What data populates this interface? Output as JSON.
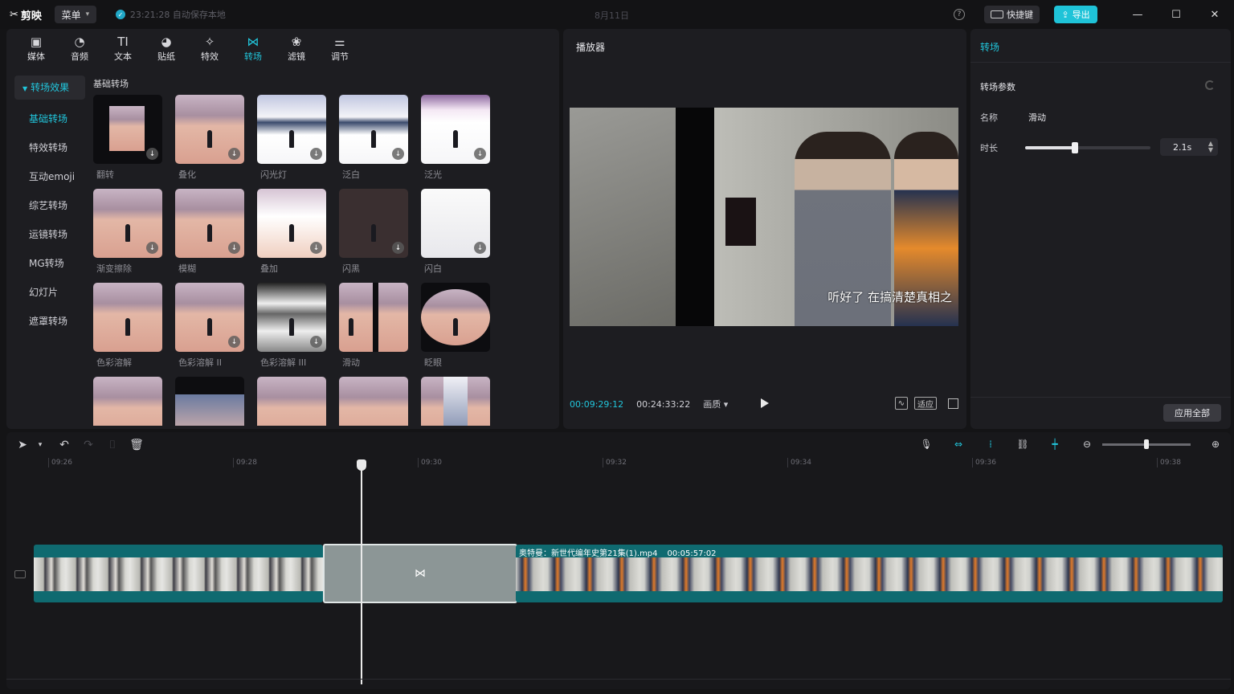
{
  "app": {
    "logo_text": "剪映",
    "menu_label": "菜单",
    "autosave_text": "23:21:28 自动保存本地",
    "project_title": "8月11日",
    "shortcut_label": "快捷键",
    "export_label": "导出"
  },
  "tools": [
    {
      "label": "媒体",
      "icon": "media-icon"
    },
    {
      "label": "音频",
      "icon": "audio-icon"
    },
    {
      "label": "文本",
      "icon": "text-icon"
    },
    {
      "label": "贴纸",
      "icon": "sticker-icon"
    },
    {
      "label": "特效",
      "icon": "effects-icon"
    },
    {
      "label": "转场",
      "icon": "transition-icon",
      "active": true
    },
    {
      "label": "滤镜",
      "icon": "filter-icon"
    },
    {
      "label": "调节",
      "icon": "adjust-icon"
    }
  ],
  "categories": {
    "header": "转场效果",
    "items": [
      "基础转场",
      "特效转场",
      "互动emoji",
      "综艺转场",
      "运镜转场",
      "MG转场",
      "幻灯片",
      "遮罩转场"
    ],
    "selected_index": 0
  },
  "section_title": "基础转场",
  "transitions": [
    "翻转",
    "叠化",
    "闪光灯",
    "泛白",
    "泛光",
    "渐变擦除",
    "模糊",
    "叠加",
    "闪黑",
    "闪白",
    "色彩溶解",
    "色彩溶解 II",
    "色彩溶解 III",
    "滑动",
    "眨眼",
    "",
    "",
    "",
    "",
    ""
  ],
  "player": {
    "title": "播放器",
    "subtitle": "听好了 在搞清楚真相之",
    "current_time": "00:09:29:12",
    "total_time": "00:24:33:22",
    "quality": "画质",
    "btn_fit": "适应"
  },
  "inspector": {
    "tab": "转场",
    "section": "转场参数",
    "name_label": "名称",
    "name_value": "滑动",
    "duration_label": "时长",
    "duration_value": "2.1s",
    "duration_fraction": 0.4,
    "apply_all": "应用全部"
  },
  "timeline": {
    "ruler": [
      "09:26",
      "09:28",
      "09:30",
      "09:32",
      "09:34",
      "09:36",
      "09:38"
    ],
    "clip_name": "奥特曼：新世代编年史第21集(1).mp4",
    "clip_duration": "00:05:57:02",
    "zoom_fraction": 0.5
  },
  "colors": {
    "accent": "#21c6dc",
    "panel": "#1d1d21",
    "track": "#0f6a70"
  }
}
